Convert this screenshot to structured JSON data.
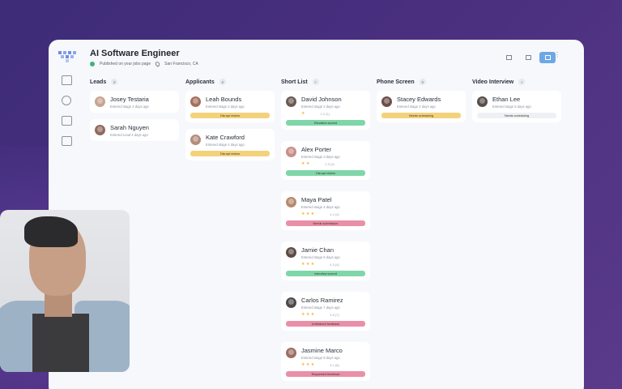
{
  "header": {
    "title": "AI Software Engineer",
    "status": "Published on your jobs page",
    "location": "San Francisco, CA"
  },
  "colors": {
    "active_toggle": "#6ea7e6",
    "pill_yellow": "#f3d27c",
    "pill_green": "#7fd6a9",
    "pill_pink": "#e98fa8",
    "pill_gray": "#eef0f4",
    "star": "#f2b632"
  },
  "columns": [
    {
      "label": "Leads",
      "count": "2",
      "cards": [
        {
          "name": "Josey Testaria",
          "meta": "Entered stage 3 days ago",
          "avatar": "#c7a48f"
        },
        {
          "name": "Sarah Nguyen",
          "meta": "Entered Lead 4 days ago",
          "avatar": "#8f6a5e"
        }
      ]
    },
    {
      "label": "Applicants",
      "count": "2",
      "cards": [
        {
          "name": "Leah Bounds",
          "meta": "Entered stage 2 days ago",
          "avatar": "#a56f5c",
          "pill": "Disrupt review",
          "pill_color": "#f3d27c"
        },
        {
          "name": "Kate Crawford",
          "meta": "Entered stage 4 days ago",
          "avatar": "#b28d7a",
          "pill": "Disrupt review",
          "pill_color": "#f3d27c"
        }
      ]
    },
    {
      "label": "Short List",
      "count": "+",
      "cards": [
        {
          "name": "David Johnson",
          "meta": "Entered stage 2 days ago",
          "avatar": "#6b5a52",
          "stars": "★",
          "score": "1.2 (1)",
          "pill": "Elevation scored",
          "pill_color": "#7fd6a9"
        },
        {
          "name": "Alex Porter",
          "meta": "Entered stage 3 days ago",
          "avatar": "#c98d86",
          "stars": "★ ★",
          "score": "2.3 (2)",
          "pill": "Disrupt review",
          "pill_color": "#7fd6a9"
        },
        {
          "name": "Maya Patel",
          "meta": "Entered stage 4 days ago",
          "avatar": "#b78a6d",
          "stars": "★ ★ ★",
          "score": "4.2 (4)",
          "pill": "Needs submission",
          "pill_color": "#e98fa8"
        },
        {
          "name": "Jamie Chan",
          "meta": "Entered stage 5 days ago",
          "avatar": "#5c4b45",
          "stars": "★ ★ ★",
          "score": "4.3 (4)",
          "pill": "Interview scored",
          "pill_color": "#7fd6a9"
        },
        {
          "name": "Carlos Ramirez",
          "meta": "Entered stage 7 days ago",
          "avatar": "#4d4a49",
          "stars": "★ ★ ★",
          "score": "3.9 (7)",
          "pill": "Unfinished feedback",
          "pill_color": "#e98fa8"
        },
        {
          "name": "Jasmine Marco",
          "meta": "Entered stage 8 days ago",
          "avatar": "#9c6f62",
          "stars": "★ ★ ★",
          "score": "4.1 (8)",
          "pill": "Requested feedback",
          "pill_color": "#e98fa8"
        }
      ]
    },
    {
      "label": "Phone Screen",
      "count": "3",
      "cards": [
        {
          "name": "Stacey Edwards",
          "meta": "Entered stage 2 days ago",
          "avatar": "#6a4f48",
          "pill": "Needs scheduling",
          "pill_color": "#f3d27c"
        }
      ]
    },
    {
      "label": "Video Interview",
      "count": "+",
      "cards": [
        {
          "name": "Ethan Lee",
          "meta": "Entered stage 5 days ago",
          "avatar": "#574d49",
          "pill": "Needs scheduling",
          "pill_color": "#eef0f4"
        }
      ]
    }
  ]
}
